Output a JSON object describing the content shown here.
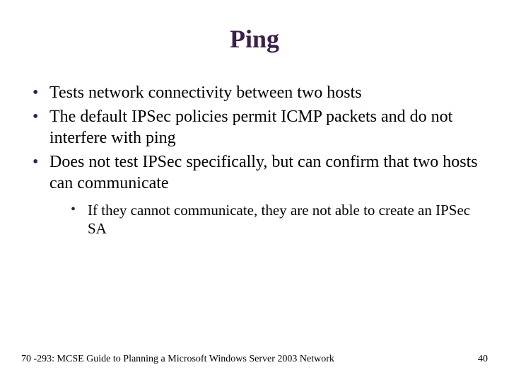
{
  "title": "Ping",
  "bullets": {
    "b1": "Tests network connectivity between two hosts",
    "b2": "The default IPSec policies permit ICMP packets and do not interfere with ping",
    "b3": "Does not test IPSec specifically, but can confirm that two hosts can communicate",
    "b3_sub1": "If they cannot communicate, they are not able to create an IPSec SA"
  },
  "footer": {
    "left": "70 -293: MCSE Guide to Planning a Microsoft Windows Server 2003 Network",
    "right": "40"
  }
}
